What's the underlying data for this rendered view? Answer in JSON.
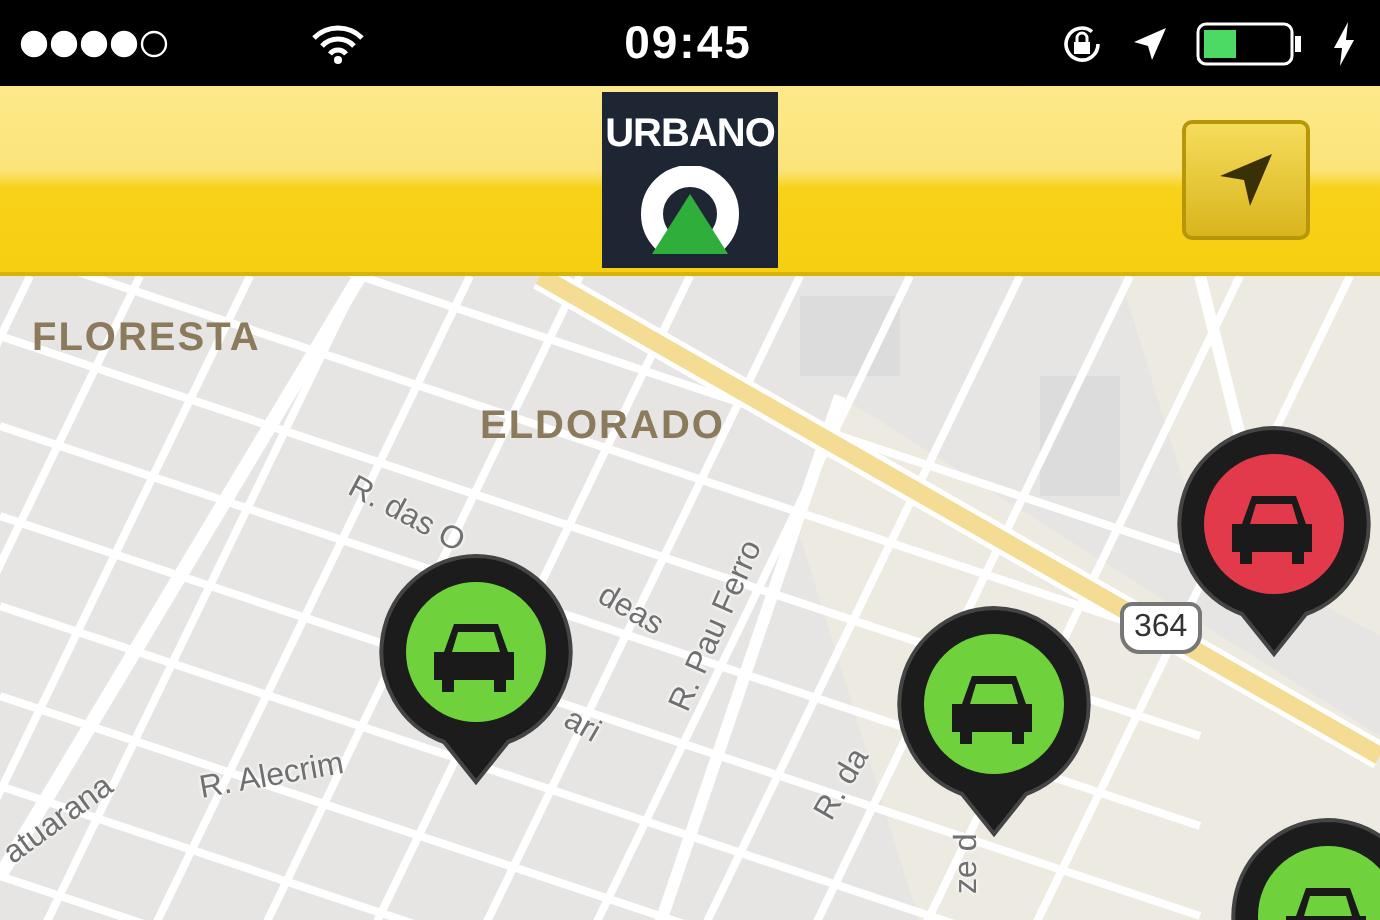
{
  "status_bar": {
    "time": "09:45"
  },
  "header": {
    "logo_text": "URBANO"
  },
  "map": {
    "area_labels": [
      "FLORESTA",
      "ELDORADO"
    ],
    "street_labels": [
      "R. das O",
      "deas",
      "ari",
      "R. Pau Ferro",
      "R. Alecrim",
      "atuarana",
      "R. da",
      "ze d"
    ],
    "route_shield": "364",
    "car_pins": [
      {
        "color": "#6fd23c"
      },
      {
        "color": "#6fd23c"
      },
      {
        "color": "#e23a4a"
      },
      {
        "color": "#6fd23c"
      }
    ]
  }
}
